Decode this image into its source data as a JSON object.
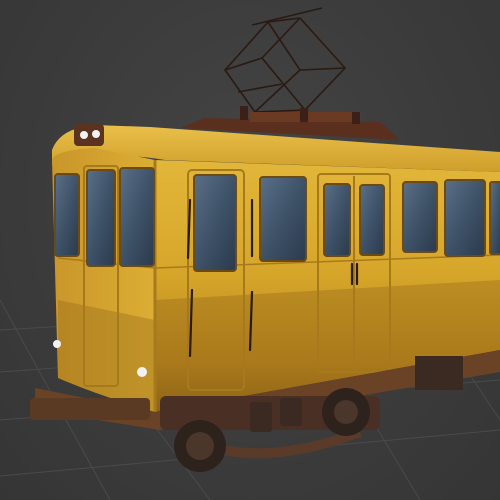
{
  "scene": {
    "subject": "yellow-tram-3d-model",
    "colors": {
      "background": "#3d3d3d",
      "grid": "#4a4a4a",
      "body": "#d6a62a",
      "body_dark": "#9e7418",
      "rust": "#7a4a1f",
      "window": "#3e5268",
      "undercarriage": "#5a3a22",
      "headlight": "#f2f2f2"
    }
  }
}
